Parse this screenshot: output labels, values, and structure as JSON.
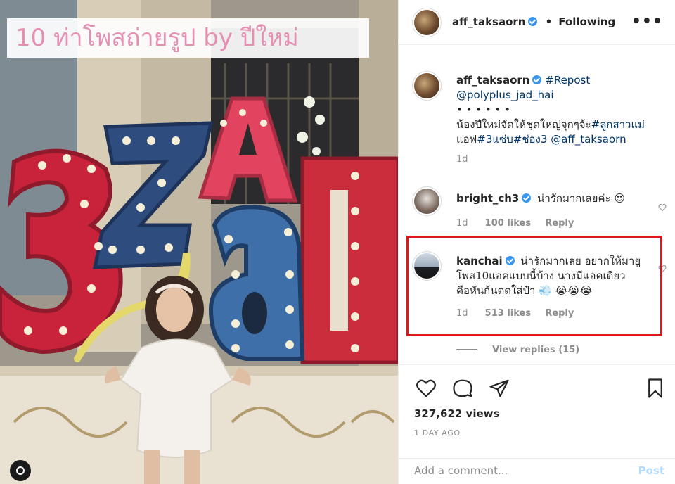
{
  "media": {
    "overlay_title": "10 ท่าโพสถ่ายรูป by ปีใหม่",
    "icon": "camera-icon"
  },
  "header": {
    "username": "aff_taksaorn",
    "separator": "•",
    "follow_status": "Following",
    "more_label": "•••"
  },
  "caption": {
    "username": "aff_taksaorn",
    "repost": "#Repost",
    "mention": "@polyplus_jad_hai",
    "dots": "• • • • • •",
    "line1": "น้องปีใหม่จัดให้ชุดใหญ่จุกๆจ้ะ",
    "tag1": "#ลูกสาวแม่",
    "line2_prefix": "แอฟ",
    "tag2": "#3แซ่บ",
    "tag3": "#ช่อง3",
    "mention2": "@aff_taksaorn",
    "time": "1d"
  },
  "comments": [
    {
      "username": "bright_ch3",
      "text": "น่ารักมากเลยค่ะ 😍",
      "time": "1d",
      "likes": "100 likes",
      "reply": "Reply"
    },
    {
      "username": "kanchai",
      "text_line1": "น่ารักมากเลย อยากให้มายู",
      "text_line2": "โพส10แอคแบบนี้บ้าง นางมีแอคเดียว",
      "text_line3": "คือหันก้นตดใส่ป๋า 💨 😭😭😭",
      "time": "1d",
      "likes": "513 likes",
      "reply": "Reply"
    }
  ],
  "view_replies": "View replies (15)",
  "stats": {
    "views": "327,622 views",
    "ago": "1 DAY AGO"
  },
  "comment_box": {
    "placeholder": "Add a comment...",
    "post_label": "Post"
  },
  "colors": {
    "accent_link": "#00376b",
    "verified": "#3897f0",
    "highlight": "#e0161d",
    "post_disabled": "#b3dbff"
  }
}
